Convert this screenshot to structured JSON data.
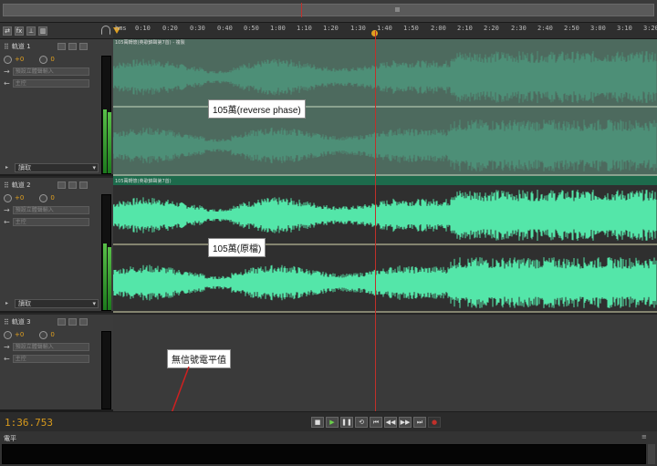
{
  "time_display": "1:36.753",
  "ruler": {
    "labels": [
      "hms",
      "0:10",
      "0:20",
      "0:30",
      "0:40",
      "0:50",
      "1:00",
      "1:10",
      "1:20",
      "1:30",
      "1:40",
      "1:50",
      "2:00",
      "2:10",
      "2:20",
      "2:30",
      "2:40",
      "2:50",
      "3:00",
      "3:10",
      "3:20"
    ]
  },
  "tracks": [
    {
      "name": "軌道 1",
      "volume": "+0",
      "pan": "0",
      "input": "預設立體聲輸入",
      "output": "主控",
      "automation": "讀取"
    },
    {
      "name": "軌道 2",
      "volume": "+0",
      "pan": "0",
      "input": "預設立體聲輸入",
      "output": "主控",
      "automation": "讀取"
    },
    {
      "name": "軌道 3",
      "volume": "+0",
      "pan": "0",
      "input": "預設立體聲輸入",
      "output": "主控"
    }
  ],
  "clips": [
    {
      "title": "105萬轉懷(英歌錦聲第7首) - 複製",
      "callout": "105萬(reverse phase)",
      "color": "#4d8f77",
      "bg": "#4d6a5e"
    },
    {
      "title": "105萬轉懷(英歌錦聲第7首)",
      "callout": "105萬(原檔)",
      "color": "#54e6a9",
      "bg": "#2f2f2f"
    }
  ],
  "annotation": "無信號電平值",
  "levels_panel": {
    "title": "電平"
  },
  "icons": [
    "headphones-icon",
    "stop-icon",
    "play-icon",
    "pause-icon",
    "loop-icon",
    "rewind-start-icon",
    "rewind-icon",
    "fast-forward-icon",
    "forward-end-icon",
    "record-icon"
  ],
  "colors": {
    "accent": "#e0a020",
    "playhead": "#c0302a",
    "waveform_active": "#54e6a9",
    "waveform_muted": "#4d8f77"
  }
}
